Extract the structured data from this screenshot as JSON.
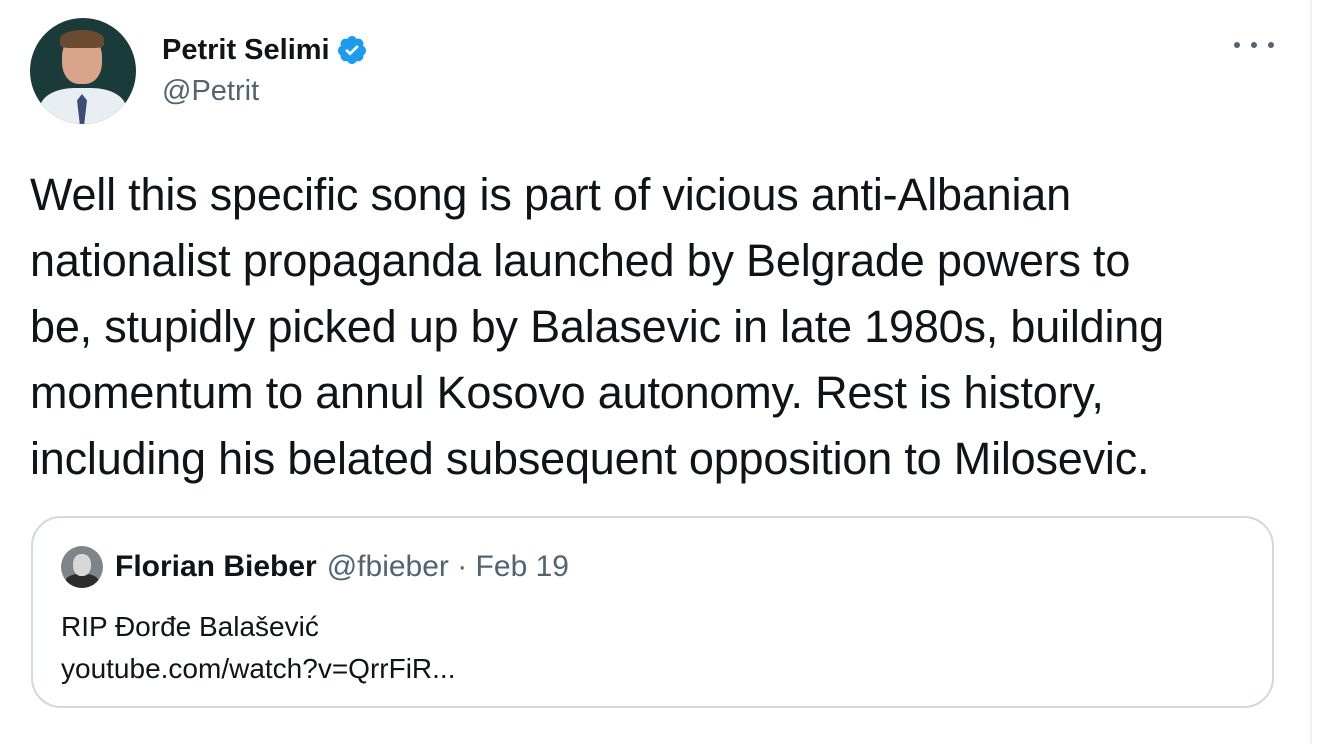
{
  "author": {
    "display_name": "Petrit Selimi",
    "handle": "@Petrit",
    "verified": true,
    "verified_badge_color": "#1d9bf0"
  },
  "menu": {
    "icon": "more-horizontal-icon"
  },
  "tweet": {
    "lines": [
      "Well this specific song is part of vicious anti-Albanian",
      "nationalist propaganda launched by Belgrade powers to",
      "be, stupidly picked up by Balasevic in late 1980s, building",
      "momentum to annul Kosovo autonomy. Rest is history,",
      "including his belated subsequent opposition to Milosevic."
    ]
  },
  "quoted_tweet": {
    "display_name": "Florian Bieber",
    "meta": "@fbieber · Feb 19",
    "text": "RIP Đorđe Balašević",
    "link": "youtube.com/watch?v=QrrFiR..."
  },
  "colors": {
    "text": "#0f1419",
    "secondary": "#536471",
    "border": "#cfd9de",
    "accent": "#1d9bf0"
  }
}
